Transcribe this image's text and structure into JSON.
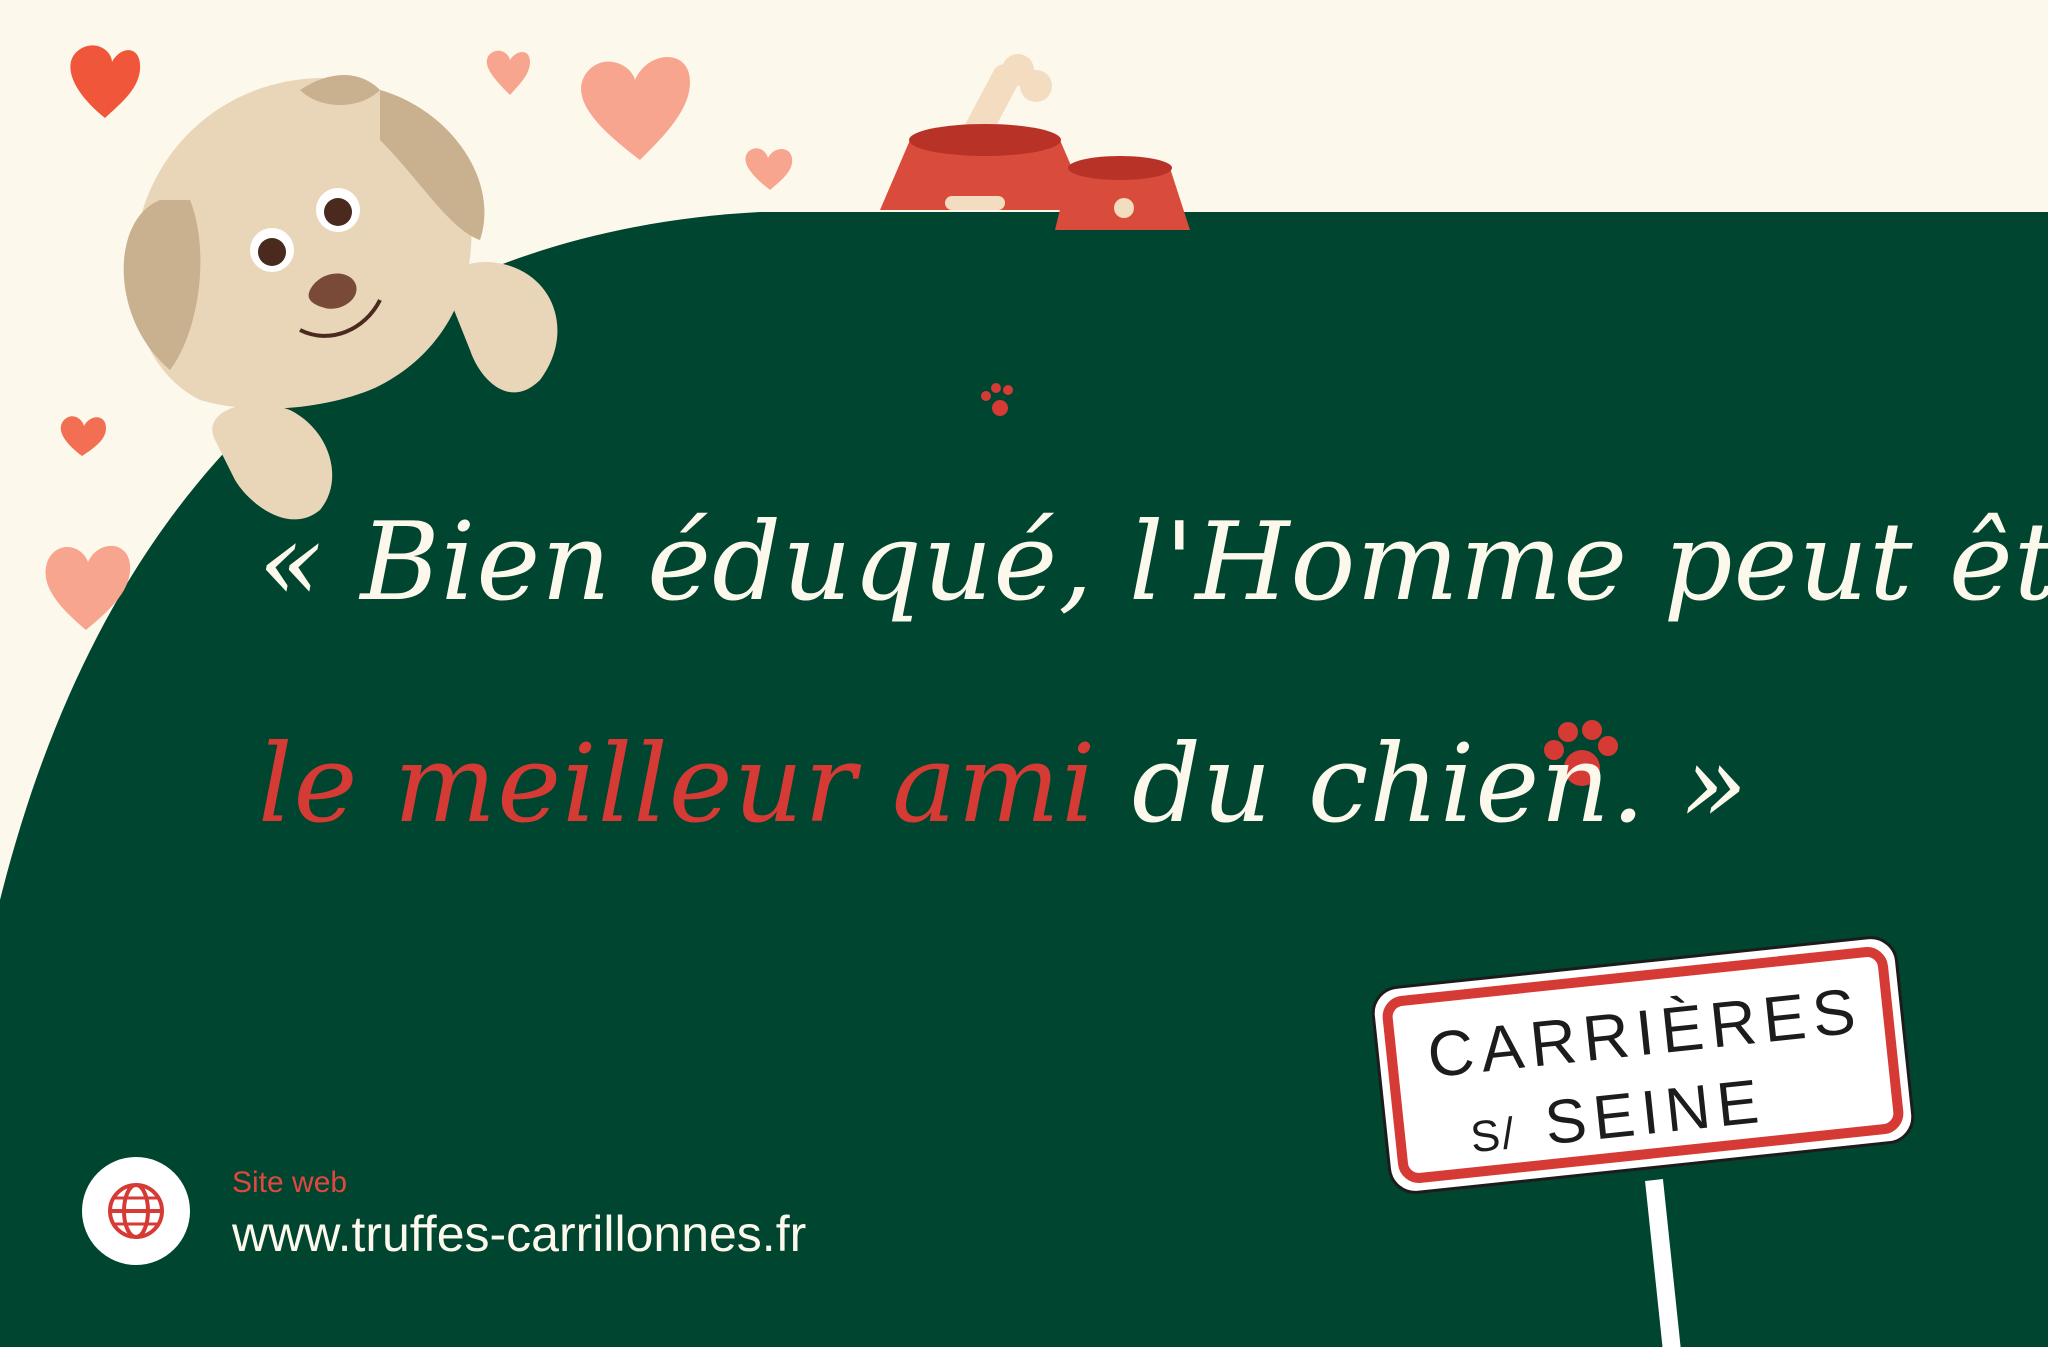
{
  "quote": {
    "open": "« Bien éduqué, l'Homme peut être",
    "accent": "le meilleur ami",
    "close": " du chien. »"
  },
  "website": {
    "label": "Site web",
    "url": "www.truffes-carrillonnes.fr",
    "icon": "globe-icon"
  },
  "sign": {
    "line1": "CARRIÈRES",
    "prefix": "S/",
    "line2": "SEINE"
  },
  "colors": {
    "background": "#fdf8ec",
    "green": "#00452f",
    "accent": "#d63a34",
    "heart": "#f7a58f",
    "heart_dark": "#f0573a"
  }
}
